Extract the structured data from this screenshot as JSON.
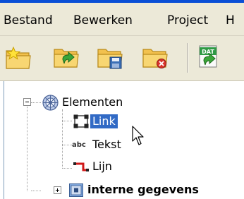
{
  "menu": [
    {
      "label": "Bestand"
    },
    {
      "label": "Bewerken"
    },
    {
      "label": "Project"
    },
    {
      "label": "H"
    }
  ],
  "toolbar": {
    "buttons": [
      {
        "icon": "new-project-folder-star-icon"
      },
      {
        "icon": "open-folder-arrow-icon"
      },
      {
        "icon": "save-folder-disk-icon"
      },
      {
        "icon": "close-folder-red-x-icon"
      },
      {
        "icon": "import-data-icon",
        "badge": "DAT"
      }
    ]
  },
  "tree": {
    "root": {
      "label": "Elementen",
      "expanded": true,
      "icon": "globe-elements-icon"
    },
    "children": [
      {
        "label": "Link",
        "icon": "link-selection-icon",
        "selected": true
      },
      {
        "label": "Tekst",
        "icon": "abc-text-icon",
        "icon_text": "abc"
      },
      {
        "label": "Lijn",
        "icon": "red-line-icon"
      }
    ],
    "second": {
      "label": "interne gegevens",
      "expanded": false,
      "icon": "internal-data-icon"
    }
  },
  "colors": {
    "selection": "#316ac5",
    "chrome": "#ece9d8",
    "title_bar": "#0a4fd6"
  }
}
